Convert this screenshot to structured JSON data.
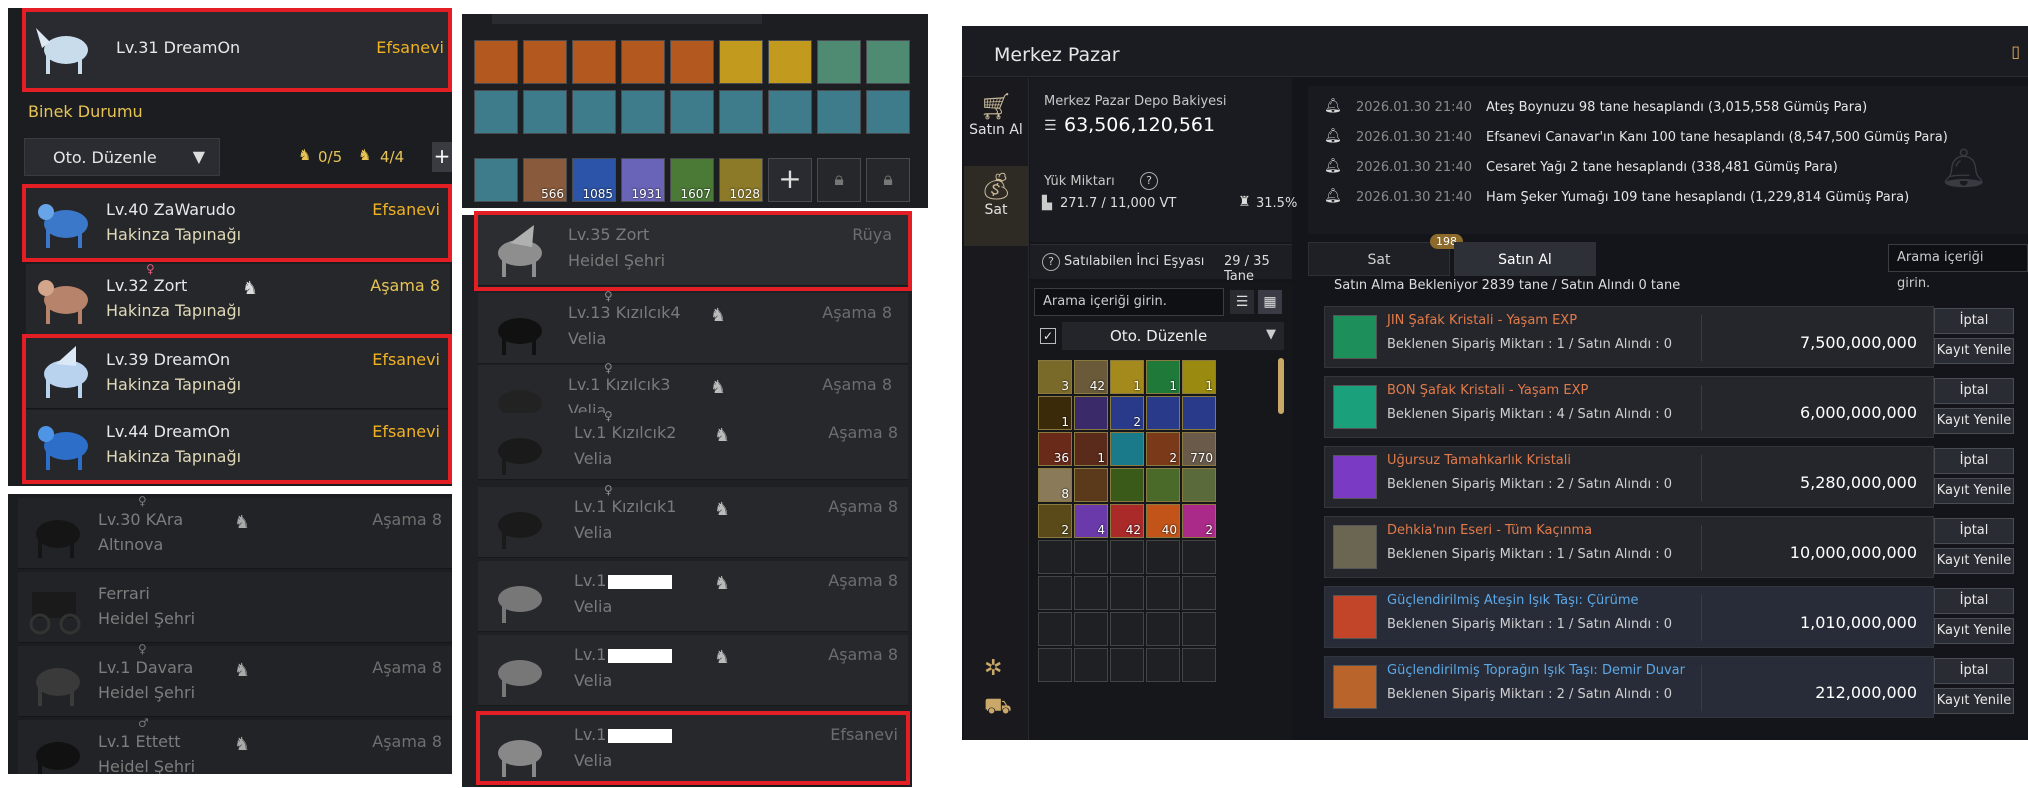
{
  "mounts": {
    "top": {
      "lvname": "Lv.31 DreamOn",
      "grade": "Efsanevi"
    },
    "status_label": "Binek Durumu",
    "sort_label": "Oto. Düzenle",
    "count_a": "0/5",
    "count_b": "4/4",
    "rows": [
      {
        "lvname": "Lv.40 ZaWarudo",
        "loc": "Hakinza Tapınağı",
        "grade": "Efsanevi",
        "gender": ""
      },
      {
        "lvname": "Lv.32 Zort",
        "loc": "Hakinza Tapınağı",
        "grade": "Aşama 8",
        "gender": "♀"
      },
      {
        "lvname": "Lv.39 DreamOn",
        "loc": "Hakinza Tapınağı",
        "grade": "Efsanevi",
        "gender": ""
      },
      {
        "lvname": "Lv.44 DreamOn",
        "loc": "Hakinza Tapınağı",
        "grade": "Efsanevi",
        "gender": ""
      },
      {
        "lvname": "Lv.30 KAra",
        "loc": "Altınova",
        "grade": "Aşama 8",
        "gender": "♀"
      },
      {
        "lvname": "Ferrari",
        "loc": "Heidel Şehri",
        "grade": "",
        "gender": ""
      },
      {
        "lvname": "Lv.1 Davara",
        "loc": "Heidel Şehri",
        "grade": "Aşama 8",
        "gender": "♀"
      },
      {
        "lvname": "Lv.1 Ettett",
        "loc": "Heidel Şehri",
        "grade": "Aşama 8",
        "gender": "♂"
      }
    ]
  },
  "inventory_top": {
    "counts": [
      "566",
      "1085",
      "1931",
      "1607",
      "1028"
    ]
  },
  "middle_list": {
    "rows": [
      {
        "lvname": "Lv.35 Zort",
        "loc": "Heidel Şehri",
        "grade": "Rüya",
        "gender": ""
      },
      {
        "lvname": "Lv.13 Kızılcık4",
        "loc": "Velia",
        "grade": "Aşama 8",
        "gender": "♀"
      },
      {
        "lvname": "Lv.1 Kızılcık3",
        "loc": "Velia",
        "grade": "Aşama 8",
        "gender": "♀"
      },
      {
        "lvname": "Lv.1 Kızılcık2",
        "loc": "Velia",
        "grade": "Aşama 8",
        "gender": "♀"
      },
      {
        "lvname": "Lv.1 Kızılcık1",
        "loc": "Velia",
        "grade": "Aşama 8",
        "gender": "♀"
      },
      {
        "lvname": "Lv.1",
        "loc": "Velia",
        "grade": "Aşama 8",
        "gender": ""
      },
      {
        "lvname": "Lv.1",
        "loc": "Velia",
        "grade": "Aşama 8",
        "gender": ""
      },
      {
        "lvname": "Lv.1",
        "loc": "Velia",
        "grade": "Efsanevi",
        "gender": ""
      }
    ]
  },
  "market": {
    "title": "Merkez Pazar",
    "nav": {
      "buy": "Satın Al",
      "sell": "Sat"
    },
    "depot_label": "Merkez Pazar Depo Bakiyesi",
    "depot_value": "63,506,120,561",
    "weight_label": "Yük Miktarı",
    "weight_value": "271.7 / 11,000 VT",
    "weight_pct": "31.5%",
    "pearl_label": "Satılabilen İnci Eşyası",
    "pearl_value": "29 / 35 Tane",
    "search_placeholder": "Arama içeriği girin.",
    "sort_label": "Oto. Düzenle",
    "notices": [
      {
        "ts": "2026.01.30 21:40",
        "msg": "Ateş Boynuzu 98 tane hesaplandı (3,015,558 Gümüş Para)"
      },
      {
        "ts": "2026.01.30 21:40",
        "msg": "Efsanevi Canavar'ın Kanı 100 tane hesaplandı (8,547,500 Gümüş Para)"
      },
      {
        "ts": "2026.01.30 21:40",
        "msg": "Cesaret Yağı 2 tane hesaplandı (338,481 Gümüş Para)"
      },
      {
        "ts": "2026.01.30 21:40",
        "msg": "Ham Şeker Yumağı 109 tane hesaplandı (1,229,814 Gümüş Para)"
      }
    ],
    "tab_sell": "Sat",
    "tab_sell_badge": "198",
    "tab_buy": "Satın Al",
    "tab_search": "Arama içeriği girin.",
    "waiting_label": "Satın Alma Bekleniyor",
    "waiting_count": "2839",
    "waiting_unit": "tane",
    "bought_label": "Satın Alındı",
    "bought_count": "0",
    "bought_unit": "tane",
    "cancel_label": "İptal",
    "renew_label": "Kayıt Yenile",
    "orders": [
      {
        "name": "JIN Şafak Kristali - Yaşam EXP",
        "sub": "Beklenen Sipariş Miktarı : 1 / Satın Alındı : 0",
        "price": "7,500,000,000",
        "color": "orange",
        "icon": "#1c8f5a"
      },
      {
        "name": "BON Şafak Kristali - Yaşam EXP",
        "sub": "Beklenen Sipariş Miktarı : 4 / Satın Alındı : 0",
        "price": "6,000,000,000",
        "color": "orange",
        "icon": "#1aa07a"
      },
      {
        "name": "Uğursuz Tamahkarlık Kristali",
        "sub": "Beklenen Sipariş Miktarı : 2 / Satın Alındı : 0",
        "price": "5,280,000,000",
        "color": "orange",
        "icon": "#7a3ac4"
      },
      {
        "name": "Dehkia'nın Eseri - Tüm Kaçınma",
        "sub": "Beklenen Sipariş Miktarı : 1 / Satın Alındı : 0",
        "price": "10,000,000,000",
        "color": "orange",
        "icon": "#6b6651"
      },
      {
        "name": "Güçlendirilmiş Ateşin Işık Taşı: Çürüme",
        "sub": "Beklenen Sipariş Miktarı : 1 / Satın Alındı : 0",
        "price": "1,010,000,000",
        "color": "blue",
        "icon": "#c2452a"
      },
      {
        "name": "Güçlendirilmiş Toprağın Işık Taşı: Demir Duvar",
        "sub": "Beklenen Sipariş Miktarı : 2 / Satın Alındı : 0",
        "price": "212,000,000",
        "color": "blue",
        "icon": "#b8642a"
      }
    ],
    "inv_counts": [
      [
        "3",
        "42",
        "1",
        "1",
        "1"
      ],
      [
        "1",
        "",
        "2",
        "",
        ""
      ],
      [
        "36",
        "1",
        "",
        "2",
        "770"
      ],
      [
        "8",
        "",
        "",
        "",
        ""
      ],
      [
        "2",
        "4",
        "42",
        "40",
        "2"
      ]
    ]
  }
}
